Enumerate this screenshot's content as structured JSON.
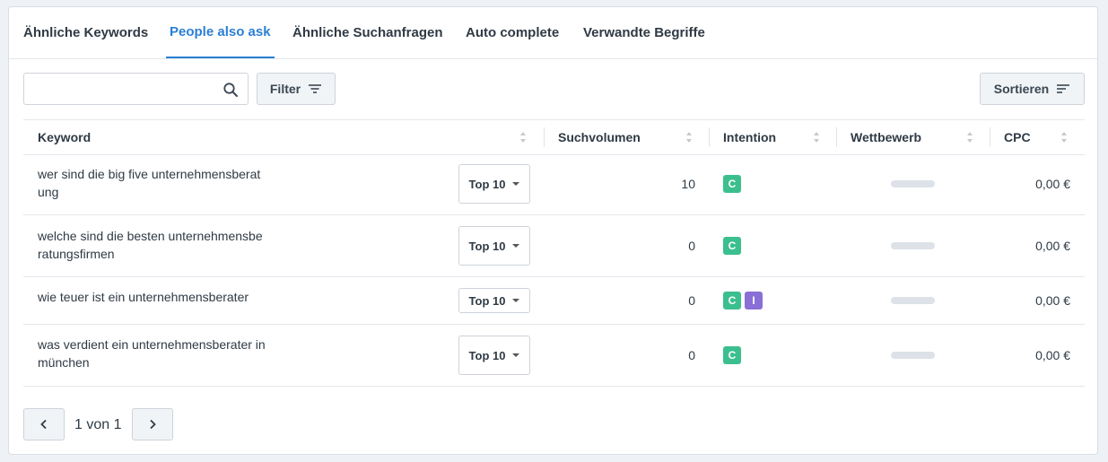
{
  "tabs": [
    {
      "label": "Ähnliche Keywords",
      "active": false
    },
    {
      "label": "People also ask",
      "active": true
    },
    {
      "label": "Ähnliche Suchanfragen",
      "active": false
    },
    {
      "label": "Auto complete",
      "active": false
    },
    {
      "label": "Verwandte Begriffe",
      "active": false
    }
  ],
  "toolbar": {
    "search_value": "",
    "filter_label": "Filter",
    "sort_label": "Sortieren"
  },
  "columns": {
    "keyword": "Keyword",
    "volume": "Suchvolumen",
    "intent": "Intention",
    "competition": "Wettbewerb",
    "cpc": "CPC"
  },
  "rows": [
    {
      "keyword_line1": "wer sind die big five unternehmensberat",
      "keyword_line2": "ung",
      "rank": "Top 10",
      "volume": "10",
      "intents": [
        "C"
      ],
      "cpc": "0,00 €"
    },
    {
      "keyword_line1": "welche sind die besten unternehmensbe",
      "keyword_line2": "ratungsfirmen",
      "rank": "Top 10",
      "volume": "0",
      "intents": [
        "C"
      ],
      "cpc": "0,00 €"
    },
    {
      "keyword_line1": "wie teuer ist ein unternehmensberater",
      "keyword_line2": "",
      "rank": "Top 10",
      "volume": "0",
      "intents": [
        "C",
        "I"
      ],
      "cpc": "0,00 €"
    },
    {
      "keyword_line1": "was verdient ein unternehmensberater in",
      "keyword_line2": "münchen",
      "rank": "Top 10",
      "volume": "0",
      "intents": [
        "C"
      ],
      "cpc": "0,00 €"
    }
  ],
  "pagination": {
    "label": "1 von 1"
  },
  "icons": {
    "search": "search-icon",
    "filter": "filter-lines-icon",
    "sort": "sort-lines-icon",
    "sorter": "sort-arrows-icon",
    "dropdown": "caret-down-icon",
    "prev": "chevron-left-icon",
    "next": "chevron-right-icon"
  },
  "colors": {
    "accent": "#2b7fd3",
    "intent_C": "#3cbf8f",
    "intent_I": "#8a6fd6"
  }
}
